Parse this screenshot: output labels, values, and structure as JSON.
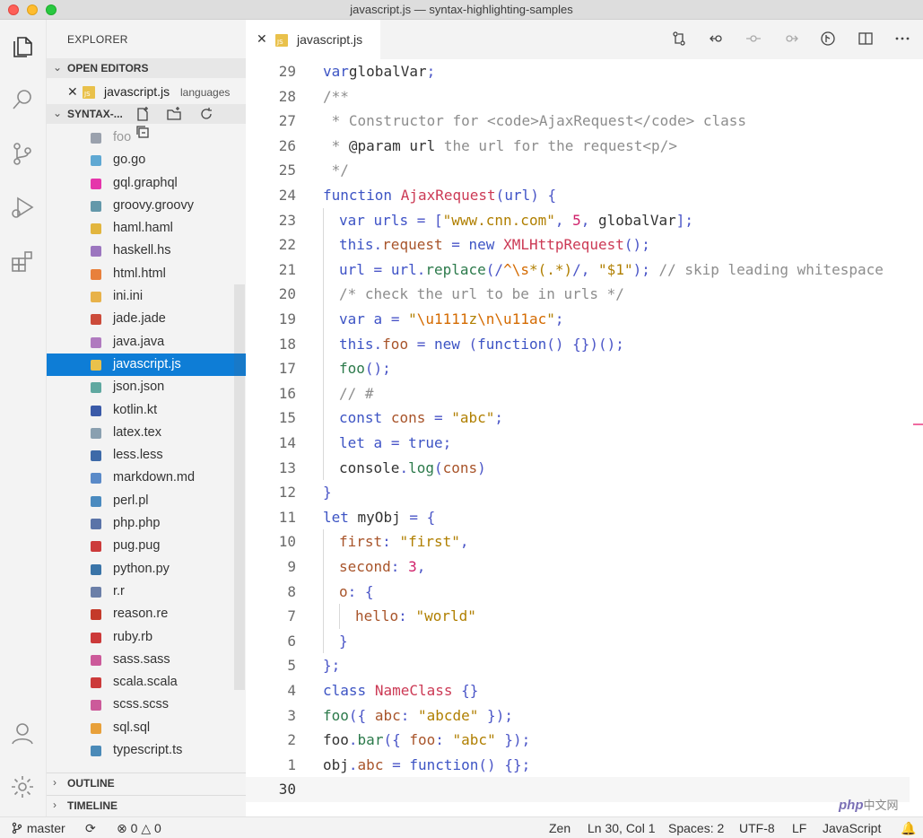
{
  "window": {
    "title": "javascript.js — syntax-highlighting-samples"
  },
  "sidebar": {
    "title": "EXPLORER",
    "open_editors": {
      "label": "OPEN EDITORS",
      "items": [
        {
          "name": "javascript.js",
          "description": "languages"
        }
      ]
    },
    "folder": {
      "label": "SYNTAX-..."
    },
    "files": [
      {
        "name": "foo",
        "icon": "file-icon",
        "color": "#9aa1ad"
      },
      {
        "name": "go.go",
        "icon": "go-icon",
        "color": "#5fa8d3"
      },
      {
        "name": "gql.graphql",
        "icon": "graphql-icon",
        "color": "#e535ab"
      },
      {
        "name": "groovy.groovy",
        "icon": "groovy-icon",
        "color": "#6398aa"
      },
      {
        "name": "haml.haml",
        "icon": "haml-icon",
        "color": "#e2b53e"
      },
      {
        "name": "haskell.hs",
        "icon": "haskell-icon",
        "color": "#9c76bf"
      },
      {
        "name": "html.html",
        "icon": "html-icon",
        "color": "#e8803b"
      },
      {
        "name": "ini.ini",
        "icon": "ini-icon",
        "color": "#e8b24a"
      },
      {
        "name": "jade.jade",
        "icon": "jade-icon",
        "color": "#cc4b3a"
      },
      {
        "name": "java.java",
        "icon": "java-icon",
        "color": "#b07abf"
      },
      {
        "name": "javascript.js",
        "icon": "js-icon",
        "color": "#e9c14b"
      },
      {
        "name": "json.json",
        "icon": "json-icon",
        "color": "#5fa8a0"
      },
      {
        "name": "kotlin.kt",
        "icon": "kotlin-icon",
        "color": "#3a5aa8"
      },
      {
        "name": "latex.tex",
        "icon": "tex-icon",
        "color": "#8aa0b0"
      },
      {
        "name": "less.less",
        "icon": "less-icon",
        "color": "#3d6aa8"
      },
      {
        "name": "markdown.md",
        "icon": "markdown-icon",
        "color": "#5a8ac8"
      },
      {
        "name": "perl.pl",
        "icon": "perl-icon",
        "color": "#4a8abf"
      },
      {
        "name": "php.php",
        "icon": "php-icon",
        "color": "#5a73a8"
      },
      {
        "name": "pug.pug",
        "icon": "pug-icon",
        "color": "#cc3a3a"
      },
      {
        "name": "python.py",
        "icon": "python-icon",
        "color": "#3a74a8"
      },
      {
        "name": "r.r",
        "icon": "r-icon",
        "color": "#6b7fa8"
      },
      {
        "name": "reason.re",
        "icon": "reason-icon",
        "color": "#c43a2a"
      },
      {
        "name": "ruby.rb",
        "icon": "ruby-icon",
        "color": "#cc3a3a"
      },
      {
        "name": "sass.sass",
        "icon": "sass-icon",
        "color": "#cc5a9a"
      },
      {
        "name": "scala.scala",
        "icon": "scala-icon",
        "color": "#cc3a3a"
      },
      {
        "name": "scss.scss",
        "icon": "scss-icon",
        "color": "#cc5a9a"
      },
      {
        "name": "sql.sql",
        "icon": "sql-icon",
        "color": "#e8a03a"
      },
      {
        "name": "typescript.ts",
        "icon": "ts-icon",
        "color": "#4a8ab8"
      }
    ],
    "selected_file": "javascript.js",
    "outline_label": "OUTLINE",
    "timeline_label": "TIMELINE"
  },
  "editor": {
    "tab": {
      "name": "javascript.js"
    },
    "lines": [
      {
        "n": "29",
        "indent": 0,
        "tokens": [
          [
            "kw",
            "var"
          ],
          [
            "",
            "globalVar"
          ],
          [
            "punc",
            ";"
          ]
        ]
      },
      {
        "n": "28",
        "indent": 0,
        "tokens": [
          [
            "cm",
            "/**"
          ]
        ]
      },
      {
        "n": "27",
        "indent": 0,
        "tokens": [
          [
            "cm",
            " * Constructor for <code>AjaxRequest</code> class"
          ]
        ]
      },
      {
        "n": "26",
        "indent": 0,
        "tokens": [
          [
            "cm",
            " * "
          ],
          [
            "",
            "@param url"
          ],
          [
            "cm",
            " the url for the request<p/>"
          ]
        ]
      },
      {
        "n": "25",
        "indent": 0,
        "tokens": [
          [
            "cm",
            " */"
          ]
        ]
      },
      {
        "n": "24",
        "indent": 0,
        "tokens": [
          [
            "kw",
            "function"
          ],
          [
            "",
            " "
          ],
          [
            "fn",
            "AjaxRequest"
          ],
          [
            "punc",
            "("
          ],
          [
            "var",
            "url"
          ],
          [
            "punc",
            ") {"
          ]
        ]
      },
      {
        "n": "23",
        "indent": 1,
        "tokens": [
          [
            "kw",
            "var"
          ],
          [
            "var",
            " urls "
          ],
          [
            "punc",
            "= ["
          ],
          [
            "str",
            "\"www.cnn.com\""
          ],
          [
            "punc",
            ", "
          ],
          [
            "num-t",
            "5"
          ],
          [
            "punc",
            ", "
          ],
          [
            "",
            "globalVar"
          ],
          [
            "punc",
            "];"
          ]
        ]
      },
      {
        "n": "22",
        "indent": 1,
        "tokens": [
          [
            "kw",
            "this"
          ],
          [
            "punc",
            "."
          ],
          [
            "prop",
            "request"
          ],
          [
            "punc",
            " = "
          ],
          [
            "kw",
            "new"
          ],
          [
            "",
            " "
          ],
          [
            "fn",
            "XMLHttpRequest"
          ],
          [
            "punc",
            "();"
          ]
        ]
      },
      {
        "n": "21",
        "indent": 1,
        "tokens": [
          [
            "var",
            "url"
          ],
          [
            "punc",
            " = "
          ],
          [
            "var",
            "url"
          ],
          [
            "punc",
            "."
          ],
          [
            "mth",
            "replace"
          ],
          [
            "punc",
            "(/"
          ],
          [
            "esc",
            "^\\s"
          ],
          [
            "str",
            "*(.*)"
          ],
          [
            "punc",
            "/, "
          ],
          [
            "str",
            "\"$1\""
          ],
          [
            "punc",
            ");"
          ],
          [
            "cm",
            " // skip leading whitespace"
          ]
        ]
      },
      {
        "n": "20",
        "indent": 1,
        "tokens": [
          [
            "cm",
            "/* check the url to be in urls */"
          ]
        ]
      },
      {
        "n": "19",
        "indent": 1,
        "tokens": [
          [
            "kw",
            "var"
          ],
          [
            "var",
            " a "
          ],
          [
            "punc",
            "= "
          ],
          [
            "str",
            "\""
          ],
          [
            "esc",
            "\\u1111"
          ],
          [
            "str",
            "z"
          ],
          [
            "esc",
            "\\n\\u11ac"
          ],
          [
            "str",
            "\""
          ],
          [
            "punc",
            ";"
          ]
        ]
      },
      {
        "n": "18",
        "indent": 1,
        "tokens": [
          [
            "kw",
            "this"
          ],
          [
            "punc",
            "."
          ],
          [
            "prop",
            "foo"
          ],
          [
            "punc",
            " = "
          ],
          [
            "kw",
            "new"
          ],
          [
            "punc",
            " ("
          ],
          [
            "kw",
            "function"
          ],
          [
            "punc",
            "() {})();"
          ]
        ]
      },
      {
        "n": "17",
        "indent": 1,
        "tokens": [
          [
            "mth",
            "foo"
          ],
          [
            "punc",
            "();"
          ]
        ]
      },
      {
        "n": "16",
        "indent": 1,
        "tokens": [
          [
            "cm",
            "// #"
          ]
        ]
      },
      {
        "n": "15",
        "indent": 1,
        "tokens": [
          [
            "kw",
            "const"
          ],
          [
            "",
            " "
          ],
          [
            "prop",
            "cons"
          ],
          [
            "punc",
            " = "
          ],
          [
            "str",
            "\"abc\""
          ],
          [
            "punc",
            ";"
          ]
        ]
      },
      {
        "n": "14",
        "indent": 1,
        "tokens": [
          [
            "kw",
            "let"
          ],
          [
            "var",
            " a "
          ],
          [
            "punc",
            "= "
          ],
          [
            "kw",
            "true"
          ],
          [
            "punc",
            ";"
          ]
        ]
      },
      {
        "n": "13",
        "indent": 1,
        "tokens": [
          [
            "",
            "console"
          ],
          [
            "punc",
            "."
          ],
          [
            "mth",
            "log"
          ],
          [
            "punc",
            "("
          ],
          [
            "prop",
            "cons"
          ],
          [
            "punc",
            ")"
          ]
        ]
      },
      {
        "n": "12",
        "indent": 0,
        "tokens": [
          [
            "punc",
            "}"
          ]
        ]
      },
      {
        "n": "11",
        "indent": 0,
        "tokens": [
          [
            "kw",
            "let"
          ],
          [
            "",
            " myObj "
          ],
          [
            "punc",
            "= {"
          ]
        ]
      },
      {
        "n": "10",
        "indent": 1,
        "tokens": [
          [
            "prop",
            "first"
          ],
          [
            "punc",
            ": "
          ],
          [
            "str",
            "\"first\""
          ],
          [
            "punc",
            ","
          ]
        ]
      },
      {
        "n": "9",
        "indent": 1,
        "tokens": [
          [
            "prop",
            "second"
          ],
          [
            "punc",
            ": "
          ],
          [
            "num-t",
            "3"
          ],
          [
            "punc",
            ","
          ]
        ]
      },
      {
        "n": "8",
        "indent": 1,
        "tokens": [
          [
            "prop",
            "o"
          ],
          [
            "punc",
            ": {"
          ]
        ]
      },
      {
        "n": "7",
        "indent": 2,
        "tokens": [
          [
            "prop",
            "hello"
          ],
          [
            "punc",
            ": "
          ],
          [
            "str",
            "\"world\""
          ]
        ]
      },
      {
        "n": "6",
        "indent": 1,
        "tokens": [
          [
            "punc",
            "}"
          ]
        ]
      },
      {
        "n": "5",
        "indent": 0,
        "tokens": [
          [
            "punc",
            "};"
          ]
        ]
      },
      {
        "n": "4",
        "indent": 0,
        "tokens": [
          [
            "kw",
            "class"
          ],
          [
            "",
            " "
          ],
          [
            "fn",
            "NameClass"
          ],
          [
            "punc",
            " {}"
          ]
        ]
      },
      {
        "n": "3",
        "indent": 0,
        "tokens": [
          [
            "mth",
            "foo"
          ],
          [
            "punc",
            "({ "
          ],
          [
            "prop",
            "abc"
          ],
          [
            "punc",
            ": "
          ],
          [
            "str",
            "\"abcde\""
          ],
          [
            "punc",
            " });"
          ]
        ]
      },
      {
        "n": "2",
        "indent": 0,
        "tokens": [
          [
            "",
            "foo"
          ],
          [
            "punc",
            "."
          ],
          [
            "mth",
            "bar"
          ],
          [
            "punc",
            "({ "
          ],
          [
            "prop",
            "foo"
          ],
          [
            "punc",
            ": "
          ],
          [
            "str",
            "\"abc\""
          ],
          [
            "punc",
            " });"
          ]
        ]
      },
      {
        "n": "1",
        "indent": 0,
        "tokens": [
          [
            "",
            "obj"
          ],
          [
            "punc",
            "."
          ],
          [
            "prop",
            "abc"
          ],
          [
            "punc",
            " = "
          ],
          [
            "kw",
            "function"
          ],
          [
            "punc",
            "() {};"
          ]
        ]
      },
      {
        "n": "30",
        "indent": 0,
        "tokens": [],
        "current": true
      }
    ]
  },
  "statusbar": {
    "branch": "master",
    "errors": "0",
    "warnings": "0",
    "zen": "Zen",
    "position": "Ln 30, Col 1",
    "spaces": "Spaces: 2",
    "encoding": "UTF-8",
    "eol": "LF",
    "language": "JavaScript"
  },
  "watermark": {
    "brand": "php",
    "suffix": "中文网"
  },
  "colors": {
    "selection": "#0e7dd6",
    "accent_pink": "#f06ba0"
  }
}
